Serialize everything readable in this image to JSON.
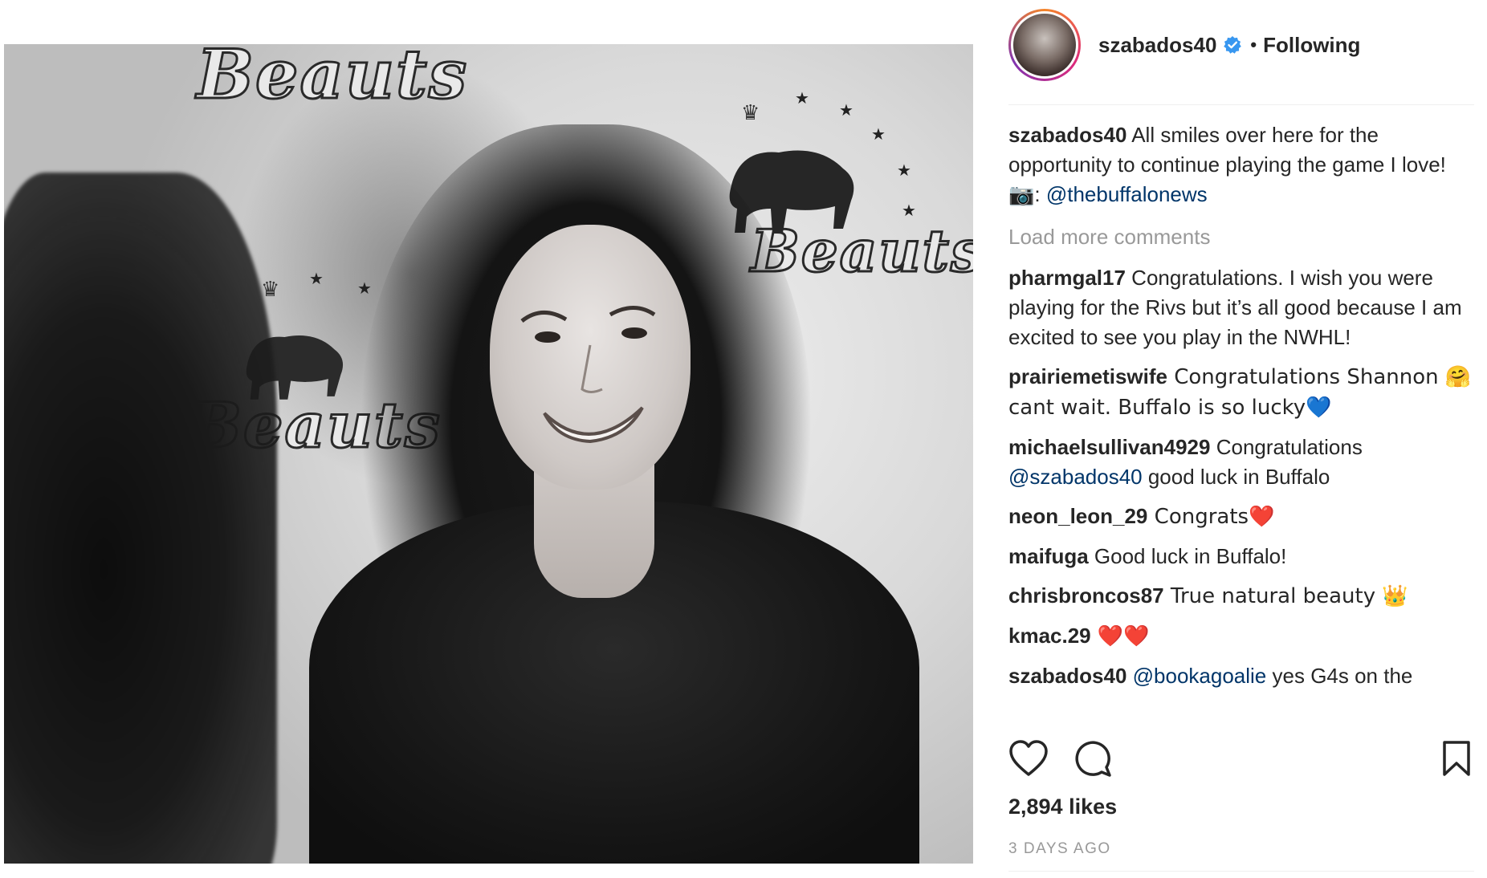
{
  "post": {
    "image_alt": "Black and white photo of a smiling woman with long curly hair in front of a Beauts backdrop",
    "backdrop_text": "Beauts"
  },
  "header": {
    "username": "szabados40",
    "separator": "•",
    "follow_status": "Following"
  },
  "caption": {
    "username": "szabados40",
    "text": " All smiles over here for the opportunity to continue playing the game I love! 📷: ",
    "mention": "@thebuffalonews"
  },
  "load_more_label": "Load more comments",
  "comments": [
    {
      "username": "pharmgal17",
      "text": " Congratulations. I wish you were playing for the Rivs but it’s all good because I am excited to see you play in the NWHL!"
    },
    {
      "username": "prairiemetiswife",
      "text": " Congratulations Shannon 🤗cant wait. Buffalo is so lucky💙"
    },
    {
      "username": "michaelsullivan4929",
      "text_before": " Congratulations ",
      "mention": "@szabados40",
      "text_after": " good luck in Buffalo"
    },
    {
      "username": "neon_leon_29",
      "text": " Congrats❤️"
    },
    {
      "username": "maifuga",
      "text": " Good luck in Buffalo!"
    },
    {
      "username": "chrisbroncos87",
      "text": " True natural beauty 👑"
    },
    {
      "username": "kmac.29",
      "text": " ❤️❤️"
    },
    {
      "username": "szabados40",
      "mention": "@bookagoalie",
      "text_after": " yes G4s on the"
    }
  ],
  "actions": {
    "like_icon": "heart-outline-icon",
    "comment_icon": "speech-bubble-icon",
    "save_icon": "bookmark-icon"
  },
  "likes_label": "2,894 likes",
  "timestamp": "3 DAYS AGO",
  "colors": {
    "text": "#262626",
    "muted": "#999999",
    "link": "#003569",
    "verified": "#3897f0",
    "divider": "#efefef"
  }
}
